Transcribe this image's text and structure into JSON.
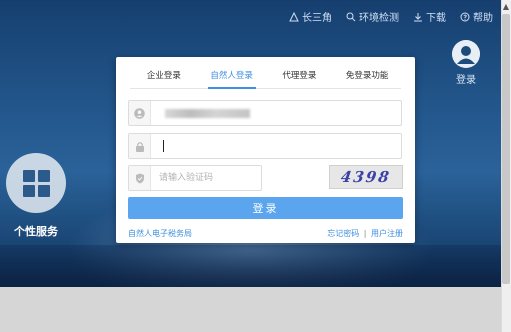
{
  "nav": {
    "items": [
      {
        "icon": "triangle-icon",
        "label": "长三角"
      },
      {
        "icon": "search-icon",
        "label": "环境检测"
      },
      {
        "icon": "download-icon",
        "label": "下载"
      },
      {
        "icon": "help-icon",
        "label": "帮助"
      }
    ]
  },
  "user": {
    "label": "登录"
  },
  "service": {
    "label": "个性服务"
  },
  "login": {
    "tabs": [
      "企业登录",
      "自然人登录",
      "代理登录",
      "免登录功能"
    ],
    "active_tab": "自然人登录",
    "captcha_placeholder": "请输入验证码",
    "captcha_text": "4398",
    "login_button": "登录",
    "footer_left": "自然人电子税务局",
    "forgot_password": "忘记密码",
    "separator": "|",
    "register": "用户注册"
  },
  "colors": {
    "accent": "#3e8fe0",
    "button": "#5aa5ee",
    "header_bg": "#1d4b7c"
  }
}
